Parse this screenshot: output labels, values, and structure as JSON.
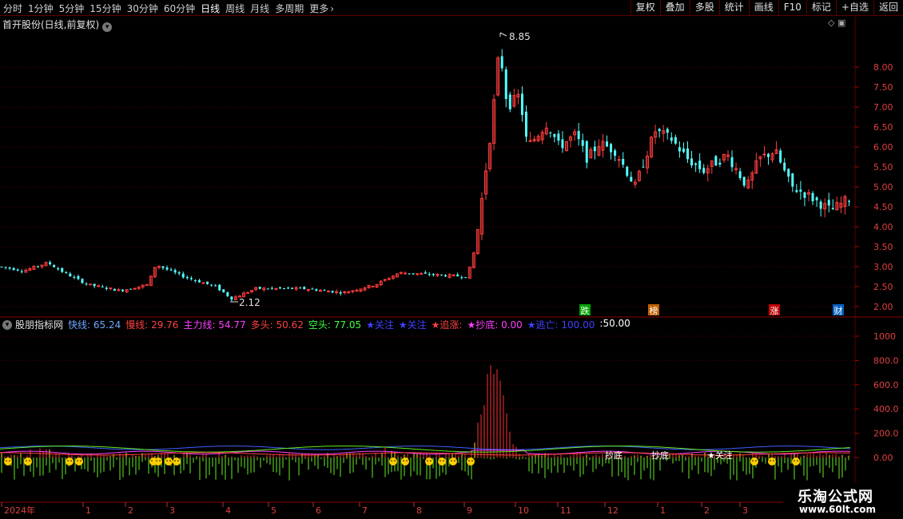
{
  "topbar": {
    "periods": [
      "分时",
      "1分钟",
      "5分钟",
      "15分钟",
      "30分钟",
      "60分钟",
      "日线",
      "周线",
      "月线",
      "多周期"
    ],
    "active_period": "日线",
    "more_label": "更多",
    "right_buttons": [
      "复权",
      "叠加",
      "多股",
      "统计",
      "画线",
      "F10",
      "标记",
      "+自选",
      "返回"
    ]
  },
  "price_panel": {
    "title": "首开股份(日线,前复权)",
    "high_label": "8.85",
    "low_label": "2.12",
    "y_ticks": [
      "8.00",
      "7.50",
      "7.00",
      "6.50",
      "6.00",
      "5.50",
      "5.00",
      "4.50",
      "4.00",
      "3.50",
      "3.00",
      "2.50",
      "2.00"
    ],
    "markers": [
      "跌",
      "榜",
      "涨",
      "财"
    ]
  },
  "indicator_panel": {
    "name": "股朋指标网",
    "fields": [
      {
        "label": "快线:",
        "value": "65.24",
        "color": "#6fa8ff"
      },
      {
        "label": "慢线:",
        "value": "29.76",
        "color": "#ff4040"
      },
      {
        "label": "主力线:",
        "value": "54.77",
        "color": "#ff40ff"
      },
      {
        "label": "多头:",
        "value": "50.62",
        "color": "#ff4040"
      },
      {
        "label": "空头:",
        "value": "77.05",
        "color": "#40ff40"
      },
      {
        "label": "★关注",
        "value": "",
        "color": "#4040ff"
      },
      {
        "label": "★关注",
        "value": "",
        "color": "#4040ff"
      },
      {
        "label": "★追涨:",
        "value": "",
        "color": "#ff4040"
      },
      {
        "label": "★抄底:",
        "value": "0.00",
        "color": "#ff40ff"
      },
      {
        "label": "★逃亡:",
        "value": "100.00",
        "color": "#4040ff"
      },
      {
        "label": ":",
        "value": "50.00",
        "color": "#ffffff"
      }
    ],
    "y_ticks": [
      "1000",
      "800.0",
      "600.0",
      "400.0",
      "200.0",
      "0.00"
    ],
    "annotations": [
      "抄底",
      "抄底",
      "★关注"
    ]
  },
  "time_axis": {
    "labels": [
      "2024年",
      "1",
      "2",
      "3",
      "4",
      "5",
      "6",
      "7",
      "8",
      "9",
      "10",
      "11",
      "12",
      "1",
      "2",
      "3"
    ]
  },
  "watermark": {
    "line1": "乐淘公式网",
    "line2": "www.60lt.com"
  },
  "colors": {
    "up": "#ff3c3c",
    "down": "#54ffff",
    "grid": "#5a0000",
    "ma_line": "#4060ff"
  }
}
